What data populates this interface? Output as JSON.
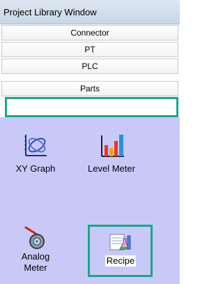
{
  "window": {
    "title": "Project Library Window"
  },
  "categories": [
    "Connector",
    "PT",
    "PLC",
    "Parts"
  ],
  "selected_category": "Parts",
  "parts": [
    {
      "label": "XY Graph",
      "icon": "xy-graph-icon"
    },
    {
      "label": "Level Meter",
      "icon": "level-meter-icon"
    },
    {
      "label": "Analog Meter",
      "label_line1": "Analog",
      "label_line2": "Meter",
      "icon": "analog-meter-icon"
    },
    {
      "label": "Recipe",
      "icon": "recipe-icon"
    }
  ],
  "colors": {
    "highlight": "#21a38a",
    "panel": "#c9c9f8",
    "title_bar": "#d3e0ee"
  }
}
